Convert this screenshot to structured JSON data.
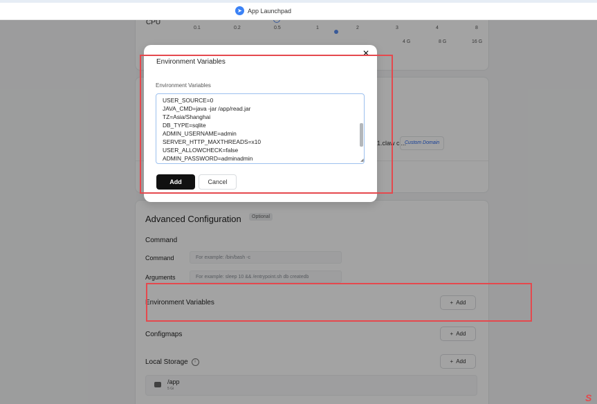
{
  "topbar": {
    "launchpad_label": "App Launchpad"
  },
  "resources": {
    "cpu_label": "CPU",
    "cpu_ticks": [
      "0.1",
      "0.2",
      "0.5",
      "1",
      "2",
      "3",
      "4",
      "8"
    ],
    "memory_ticks": [
      "4 G",
      "8 G",
      "16 G"
    ]
  },
  "network": {
    "domain_fragment": "1.claw cl...",
    "custom_domain_label": "Custom Domain"
  },
  "advanced": {
    "title": "Advanced Configuration",
    "optional_badge": "Optional",
    "command_section": "Command",
    "command_label": "Command",
    "command_placeholder": "For example:  /bin/bash -c",
    "arguments_label": "Arguments",
    "arguments_placeholder": "For example:  sleep 10 && /entrypoint.sh db createdb",
    "env_label": "Environment Variables",
    "configmaps_label": "Configmaps",
    "local_storage_label": "Local Storage",
    "add_label": "Add",
    "storage": {
      "path": "/app",
      "size": "5 Gi"
    }
  },
  "modal": {
    "title": "Environment Variables",
    "field_label": "Environment Variables",
    "env_lines": [
      "USER_SOURCE=0",
      "JAVA_CMD=java -jar /app/read.jar",
      "TZ=Asia/Shanghai",
      "DB_TYPE=sqlite",
      "ADMIN_USERNAME=admin",
      "SERVER_HTTP_MAXTHREADS=x10",
      "USER_ALLOWCHECK=false",
      "ADMIN_PASSWORD=adminadmin"
    ],
    "add_button": "Add",
    "cancel_button": "Cancel",
    "close_glyph": "✕"
  },
  "colors": {
    "highlight": "#e5484d",
    "primary_button": "#111111",
    "link": "#2563eb"
  }
}
